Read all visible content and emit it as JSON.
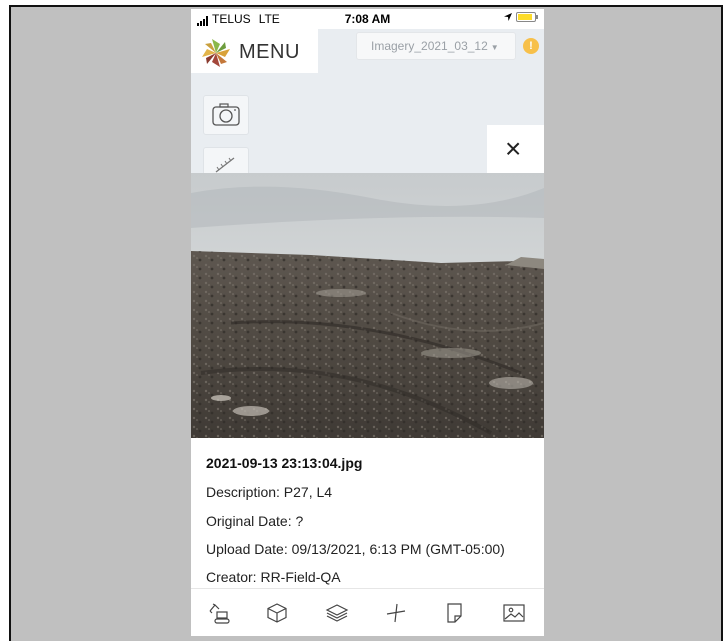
{
  "status_bar": {
    "carrier": "TELUS",
    "network": "LTE",
    "time": "7:08 AM"
  },
  "header": {
    "menu_label": "MENU",
    "imagery_select": "Imagery_2021_03_12",
    "alert_symbol": "!"
  },
  "panel": {
    "close_symbol": "×"
  },
  "photo_info": {
    "filename": "2021-09-13 23:13:04.jpg",
    "description": "Description: P27, L4",
    "original_date": "Original Date: ?",
    "upload_date": "Upload Date: 09/13/2021, 6:13 PM (GMT-05:00)",
    "creator": "Creator: RR-Field-QA"
  },
  "toolbar": {
    "icons": [
      "excavator-icon",
      "cube-icon",
      "layers-icon",
      "measure-icon",
      "document-icon",
      "image-icon"
    ]
  },
  "colors": {
    "frame": "#c0c0c0",
    "panel_bg": "#e9edf1",
    "warning": "#f7c04a",
    "battery": "#fddc2a"
  }
}
